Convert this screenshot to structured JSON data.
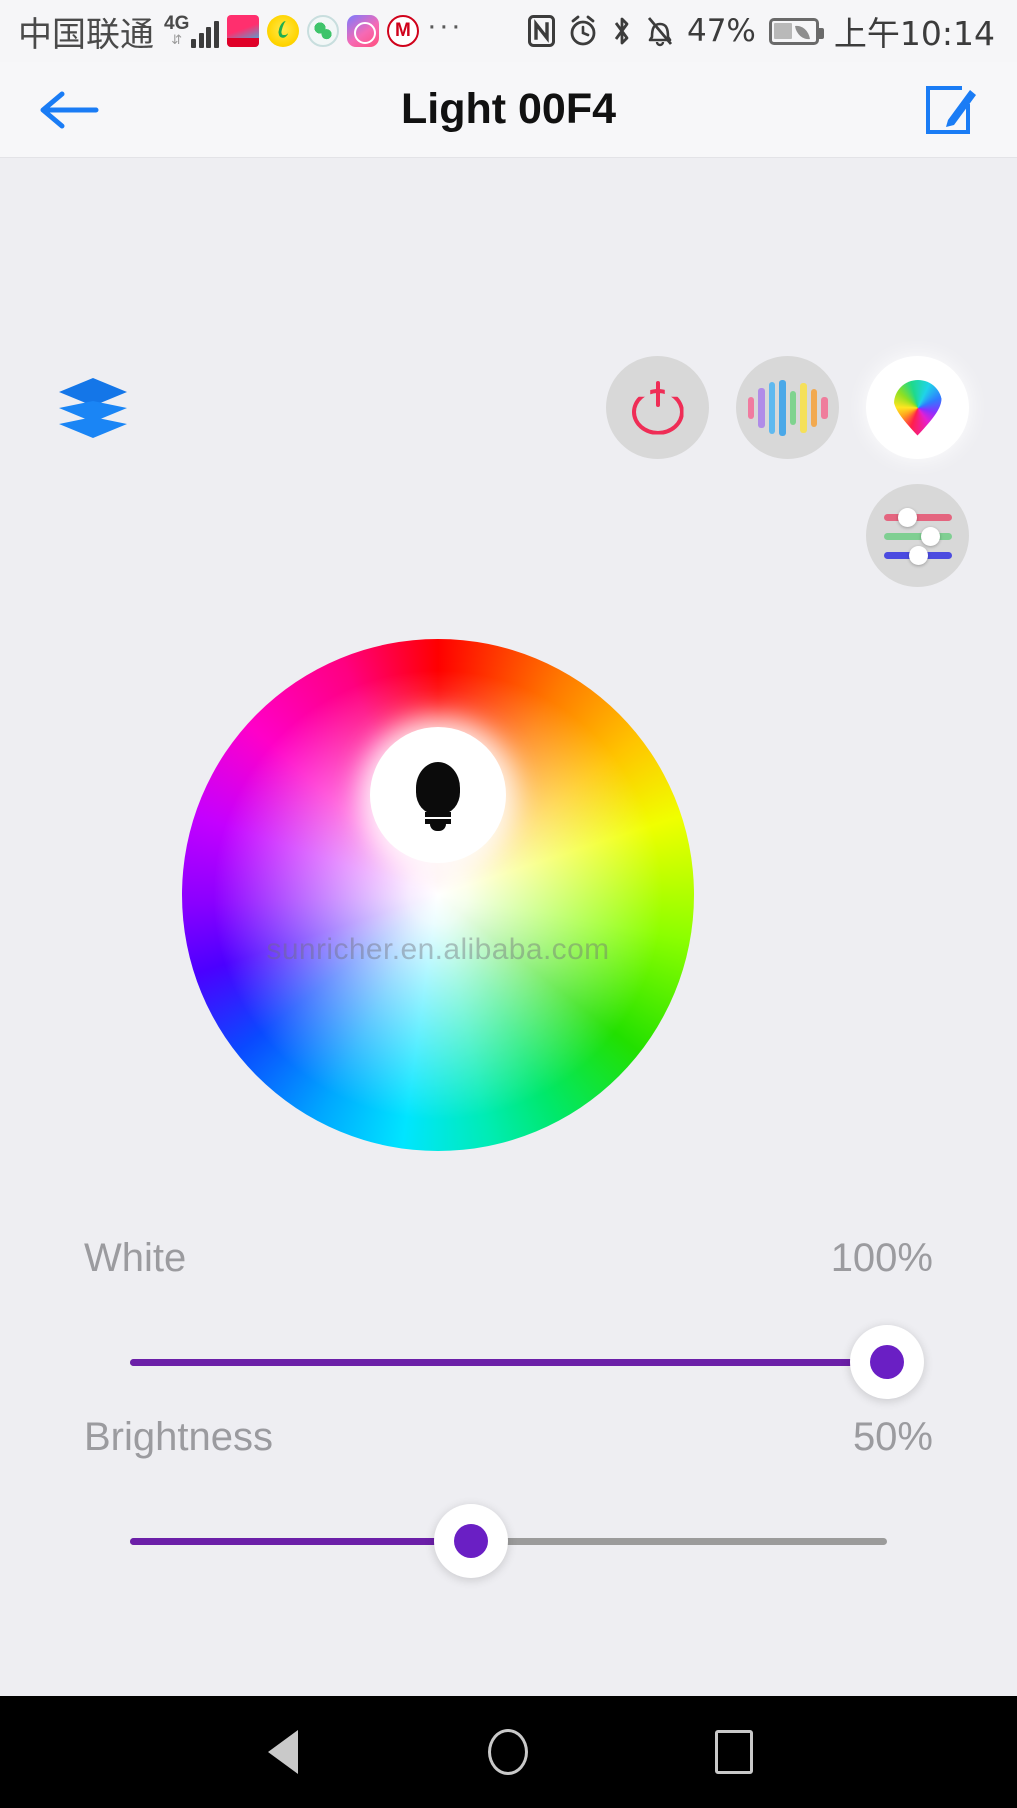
{
  "status_bar": {
    "carrier": "中国联通",
    "network_type": "4G",
    "network_sub": "↓↑",
    "signal_bars": 4,
    "app_icons": [
      "video-app-icon",
      "music-app-icon",
      "browser-app-icon",
      "clock-app-icon",
      "bank-app-icon"
    ],
    "overflow": "···",
    "indicators": [
      "nfc-icon",
      "alarm-icon",
      "bluetooth-icon",
      "silent-mode-icon"
    ],
    "battery_percent": "47%",
    "battery_saver": true,
    "time": "上午10:14"
  },
  "app_bar": {
    "back_label": "back-arrow",
    "title": "Light 00F4",
    "edit_label": "edit-pencil"
  },
  "controls": {
    "groups_icon": "layers-icon",
    "modes": [
      {
        "name": "power",
        "icon": "power-icon",
        "active": false
      },
      {
        "name": "music",
        "icon": "equalizer-icon",
        "active": false
      },
      {
        "name": "color",
        "icon": "color-droplet-icon",
        "active": true
      }
    ],
    "settings": {
      "name": "rgb-settings",
      "icon": "sliders-icon"
    }
  },
  "color_wheel": {
    "selector_icon": "lightbulb-icon",
    "selected_color": "#ffffff",
    "watermark": "sunricher.en.alibaba.com"
  },
  "sliders": [
    {
      "label": "White",
      "value_text": "100%",
      "percent": 100,
      "fill_color": "#6b1fa8",
      "track_color": "#9b9b9b",
      "knob_color": "#6a1fc4"
    },
    {
      "label": "Brightness",
      "value_text": "50%",
      "percent": 50,
      "fill_color": "#6b1fa8",
      "track_color": "#9b9b9b",
      "knob_color": "#6a1fc4"
    }
  ],
  "nav_bar": {
    "back": "nav-back-triangle",
    "home": "nav-home-circle",
    "recents": "nav-recents-square"
  },
  "theme": {
    "background": "#eeeef2",
    "app_bar_bg": "#f7f7f9",
    "accent_blue": "#1a7cf5",
    "power_red": "#ef2d56",
    "title_color": "#111111",
    "muted_text": "#9b9b9f"
  }
}
